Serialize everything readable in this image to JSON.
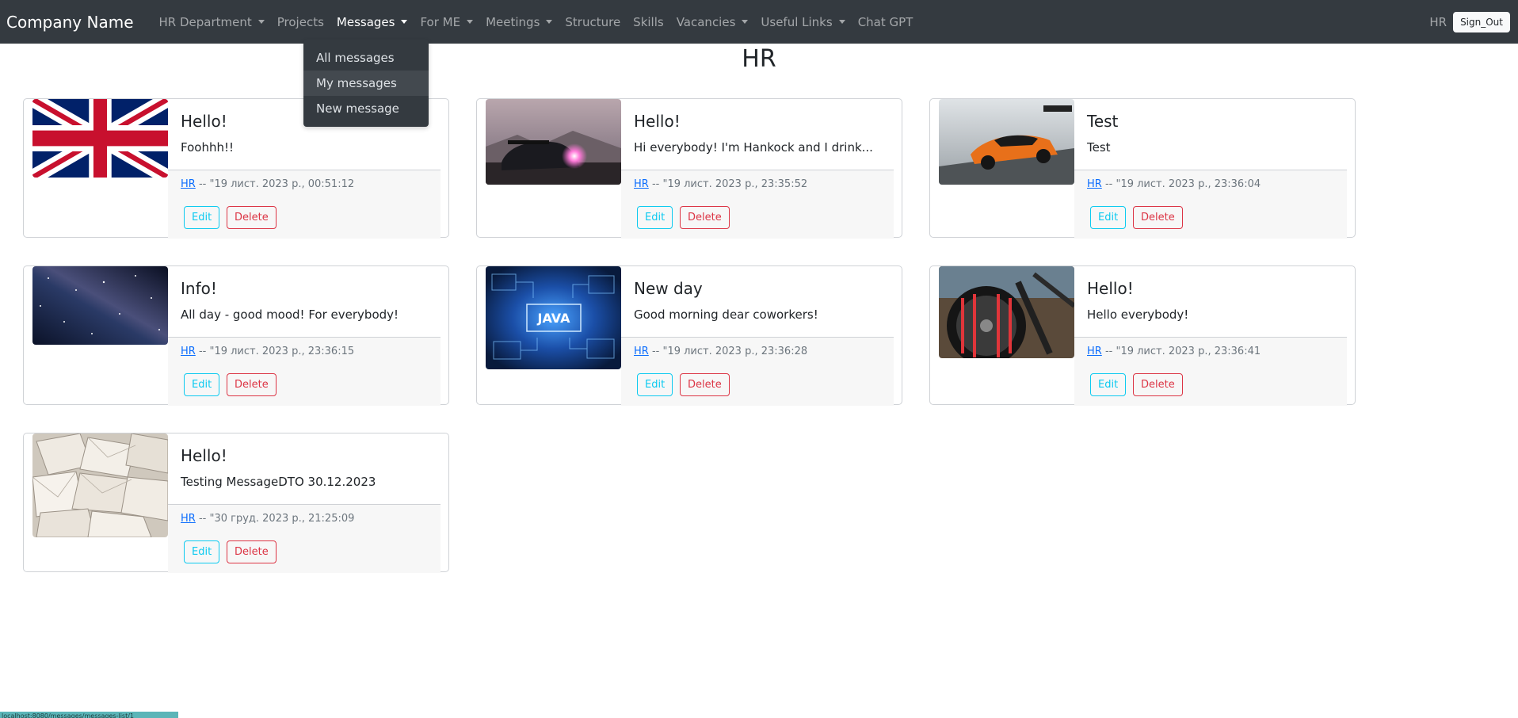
{
  "navbar": {
    "brand": "Company Name",
    "items": [
      {
        "label": "HR Department",
        "dropdown": true
      },
      {
        "label": "Projects",
        "dropdown": false
      },
      {
        "label": "Messages",
        "dropdown": true,
        "active": true
      },
      {
        "label": "For ME",
        "dropdown": true
      },
      {
        "label": "Meetings",
        "dropdown": true
      },
      {
        "label": "Structure",
        "dropdown": false
      },
      {
        "label": "Skills",
        "dropdown": false
      },
      {
        "label": "Vacancies",
        "dropdown": true
      },
      {
        "label": "Useful Links",
        "dropdown": true
      },
      {
        "label": "Chat GPT",
        "dropdown": false
      }
    ],
    "user": "HR",
    "sign_out": "Sign_Out"
  },
  "messages_menu": {
    "items": [
      "All messages",
      "My messages",
      "New message"
    ],
    "hovered": "My messages"
  },
  "page": {
    "title": "HR"
  },
  "buttons": {
    "edit": "Edit",
    "delete": "Delete"
  },
  "cards": [
    {
      "title": "Hello!",
      "text": "Foohhh!!",
      "author": "HR",
      "date": "-- \"19 лист. 2023 р., 00:51:12",
      "image": "uk-flag"
    },
    {
      "title": "Hello!",
      "text": "Hi everybody! I'm Hankock and I drink...",
      "author": "HR",
      "date": "-- \"19 лист. 2023 р., 23:35:52",
      "image": "race-car"
    },
    {
      "title": "Test",
      "text": "Test",
      "author": "HR",
      "date": "-- \"19 лист. 2023 р., 23:36:04",
      "image": "orange-supercar"
    },
    {
      "title": "Info!",
      "text": "All day - good mood! For everybody!",
      "author": "HR",
      "date": "-- \"19 лист. 2023 р., 23:36:15",
      "image": "milky-way"
    },
    {
      "title": "New day",
      "text": "Good morning dear coworkers!",
      "author": "HR",
      "date": "-- \"19 лист. 2023 р., 23:36:28",
      "image": "java-circuit",
      "image_text": "JAVA"
    },
    {
      "title": "Hello!",
      "text": "Hello everybody!",
      "author": "HR",
      "date": "-- \"19 лист. 2023 р., 23:36:41",
      "image": "bicycle-wheel"
    },
    {
      "title": "Hello!",
      "text": "Testing MessageDTO 30.12.2023",
      "author": "HR",
      "date": "-- \"30 груд. 2023 р., 21:25:09",
      "image": "envelopes"
    }
  ],
  "status_bar": {
    "text": "localhost:8080/messages/messages-list/1"
  }
}
